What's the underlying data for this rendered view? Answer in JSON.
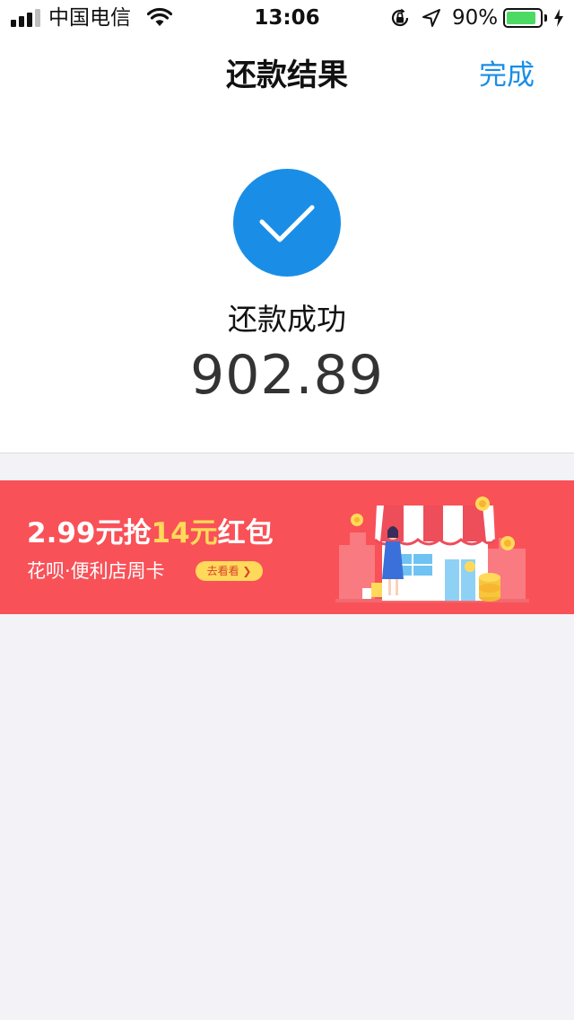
{
  "status_bar": {
    "carrier": "中国电信",
    "time": "13:06",
    "battery_percent": "90%",
    "battery_level": 0.9,
    "signal_bars_active": 3,
    "signal_bars_total": 4
  },
  "nav": {
    "title": "还款结果",
    "done_label": "完成"
  },
  "result": {
    "status_text": "还款成功",
    "amount": "902.89"
  },
  "banner": {
    "title_prefix": "2.99元抢",
    "title_highlight": "14元",
    "title_suffix": "红包",
    "subtitle": "花呗·便利店周卡",
    "cta_label": "去看看 ❯"
  },
  "colors": {
    "accent": "#1a8ee6",
    "banner_bg": "#f95158",
    "highlight": "#ffd95a",
    "battery": "#4cd964"
  }
}
